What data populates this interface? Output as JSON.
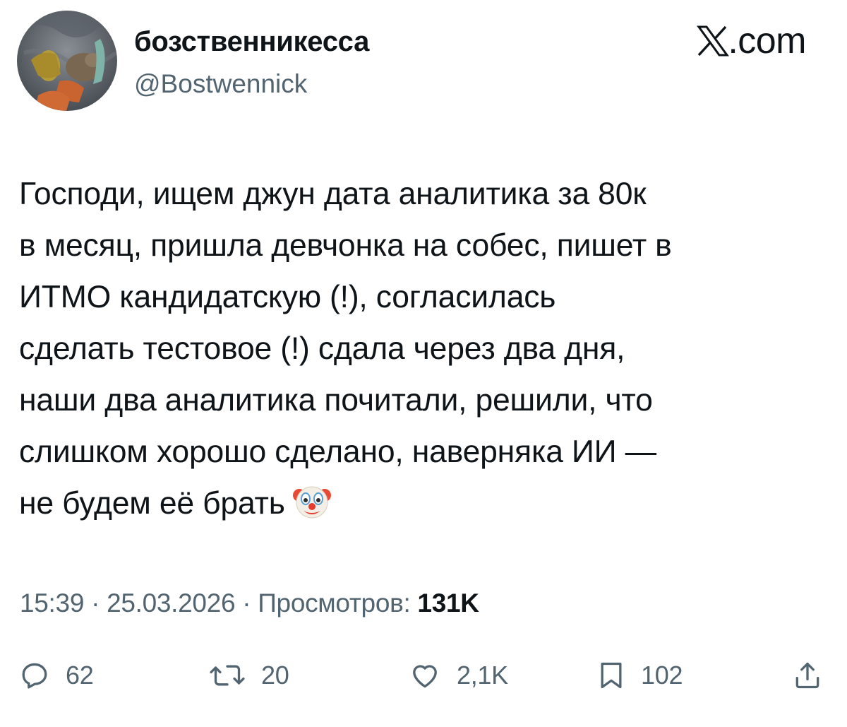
{
  "author": {
    "display_name": "бозственникесса",
    "handle": "@Bostwennick"
  },
  "brand": {
    "label": ".com",
    "logo_icon": "x-logo-icon"
  },
  "tweet": {
    "text": "Господи, ищем джун дата аналитика за 80к\nв месяц, пришла девчонка на собес, пишет в\nИТМО кандидатскую (!), согласилась\nсделать тестовое (!) сдала через два дня,\nнаши два аналитика почитали, решили, что\nслишком хорошо сделано, наверняка ИИ —\nне будем её брать",
    "emoji_icon": "clown-face-icon"
  },
  "meta": {
    "time": "15:39",
    "separator": " · ",
    "date": "25.03.2026",
    "views_label": "Просмотров: ",
    "views_count": "131K"
  },
  "actions": {
    "replies": {
      "icon": "reply-icon",
      "count": "62"
    },
    "reposts": {
      "icon": "repost-icon",
      "count": "20"
    },
    "likes": {
      "icon": "heart-icon",
      "count": "2,1K"
    },
    "bookmarks": {
      "icon": "bookmark-icon",
      "count": "102"
    },
    "share": {
      "icon": "share-icon"
    }
  },
  "colors": {
    "text_primary": "#0f1419",
    "text_secondary": "#536471",
    "background": "#ffffff"
  }
}
